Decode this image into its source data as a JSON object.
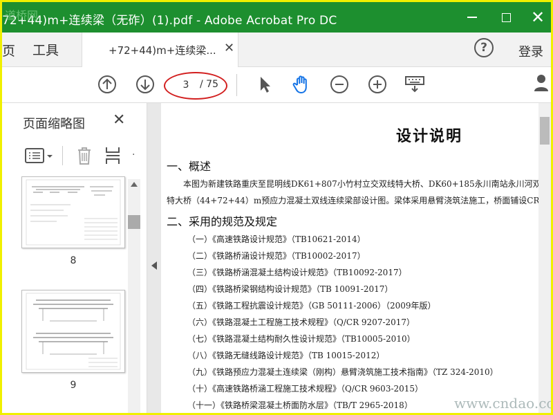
{
  "window": {
    "title": "72+44)m+连续梁（无砟）(1).pdf - Adobe Acrobat Pro DC",
    "watermark_top": "道桥网"
  },
  "tabs": {
    "home": "页",
    "tools": "工具",
    "document": "+72+44)m+连续梁...",
    "close": "✕"
  },
  "header": {
    "login": "登录",
    "help": "?"
  },
  "toolbar": {
    "current_page": "3",
    "total_pages": "/ 75"
  },
  "panel": {
    "title": "页面缩略图",
    "close": "✕",
    "thumbnails": [
      {
        "label": "8"
      },
      {
        "label": "9"
      }
    ]
  },
  "document": {
    "title": "设计说明",
    "section1": "一、概述",
    "para1_line1": "本图为新建铁路重庆至昆明线DK61+807小竹村立交双线特大桥、DK60+185永川南站永川河双线道",
    "para1_line2": "特大桥（44+72+44）m预应力混凝土双线连续梁部设计图。梁体采用悬臂浇筑法施工，桥面铺设CRT",
    "section2": "二、采用的规范及规定",
    "standards": [
      "（一）《高速铁路设计规范》（TB10621-2014）",
      "（二）《铁路桥涵设计规范》（TB10002-2017）",
      "（三）《铁路桥涵混凝土结构设计规范》（TB10092-2017）",
      "（四）《铁路桥梁钢结构设计规范》（TB 10091-2017）",
      "（五）《铁路工程抗震设计规范》（GB 50111-2006）（2009年版）",
      "（六）《铁路混凝土工程施工技术规程》（Q/CR 9207-2017）",
      "（七）《铁路混凝土结构耐久性设计规范》（TB10005-2010）",
      "（八）《铁路无缝线路设计规范》（TB 10015-2012）",
      "（九）《铁路预应力混凝土连续梁（刚构）悬臂浇筑施工技术指南》（TZ 324-2010）",
      "（十）《高速铁路桥涵工程施工技术规程》（Q/CR 9603-2015）",
      "（十一）《铁路桥梁混凝土桥面防水层》（TB/T 2965-2018）"
    ]
  },
  "watermark_bottom": "www.cndao.com",
  "icons": {
    "prev_page": "arrow-up-circle-icon",
    "next_page": "arrow-down-circle-icon",
    "select": "cursor-icon",
    "hand": "hand-icon",
    "zoom_out": "minus-circle-icon",
    "zoom_in": "plus-circle-icon",
    "keyboard": "keyboard-icon"
  },
  "colors": {
    "titlebar": "#1d8f2f",
    "highlight_ellipse": "#d21e1e",
    "hand_active": "#1473e6"
  }
}
